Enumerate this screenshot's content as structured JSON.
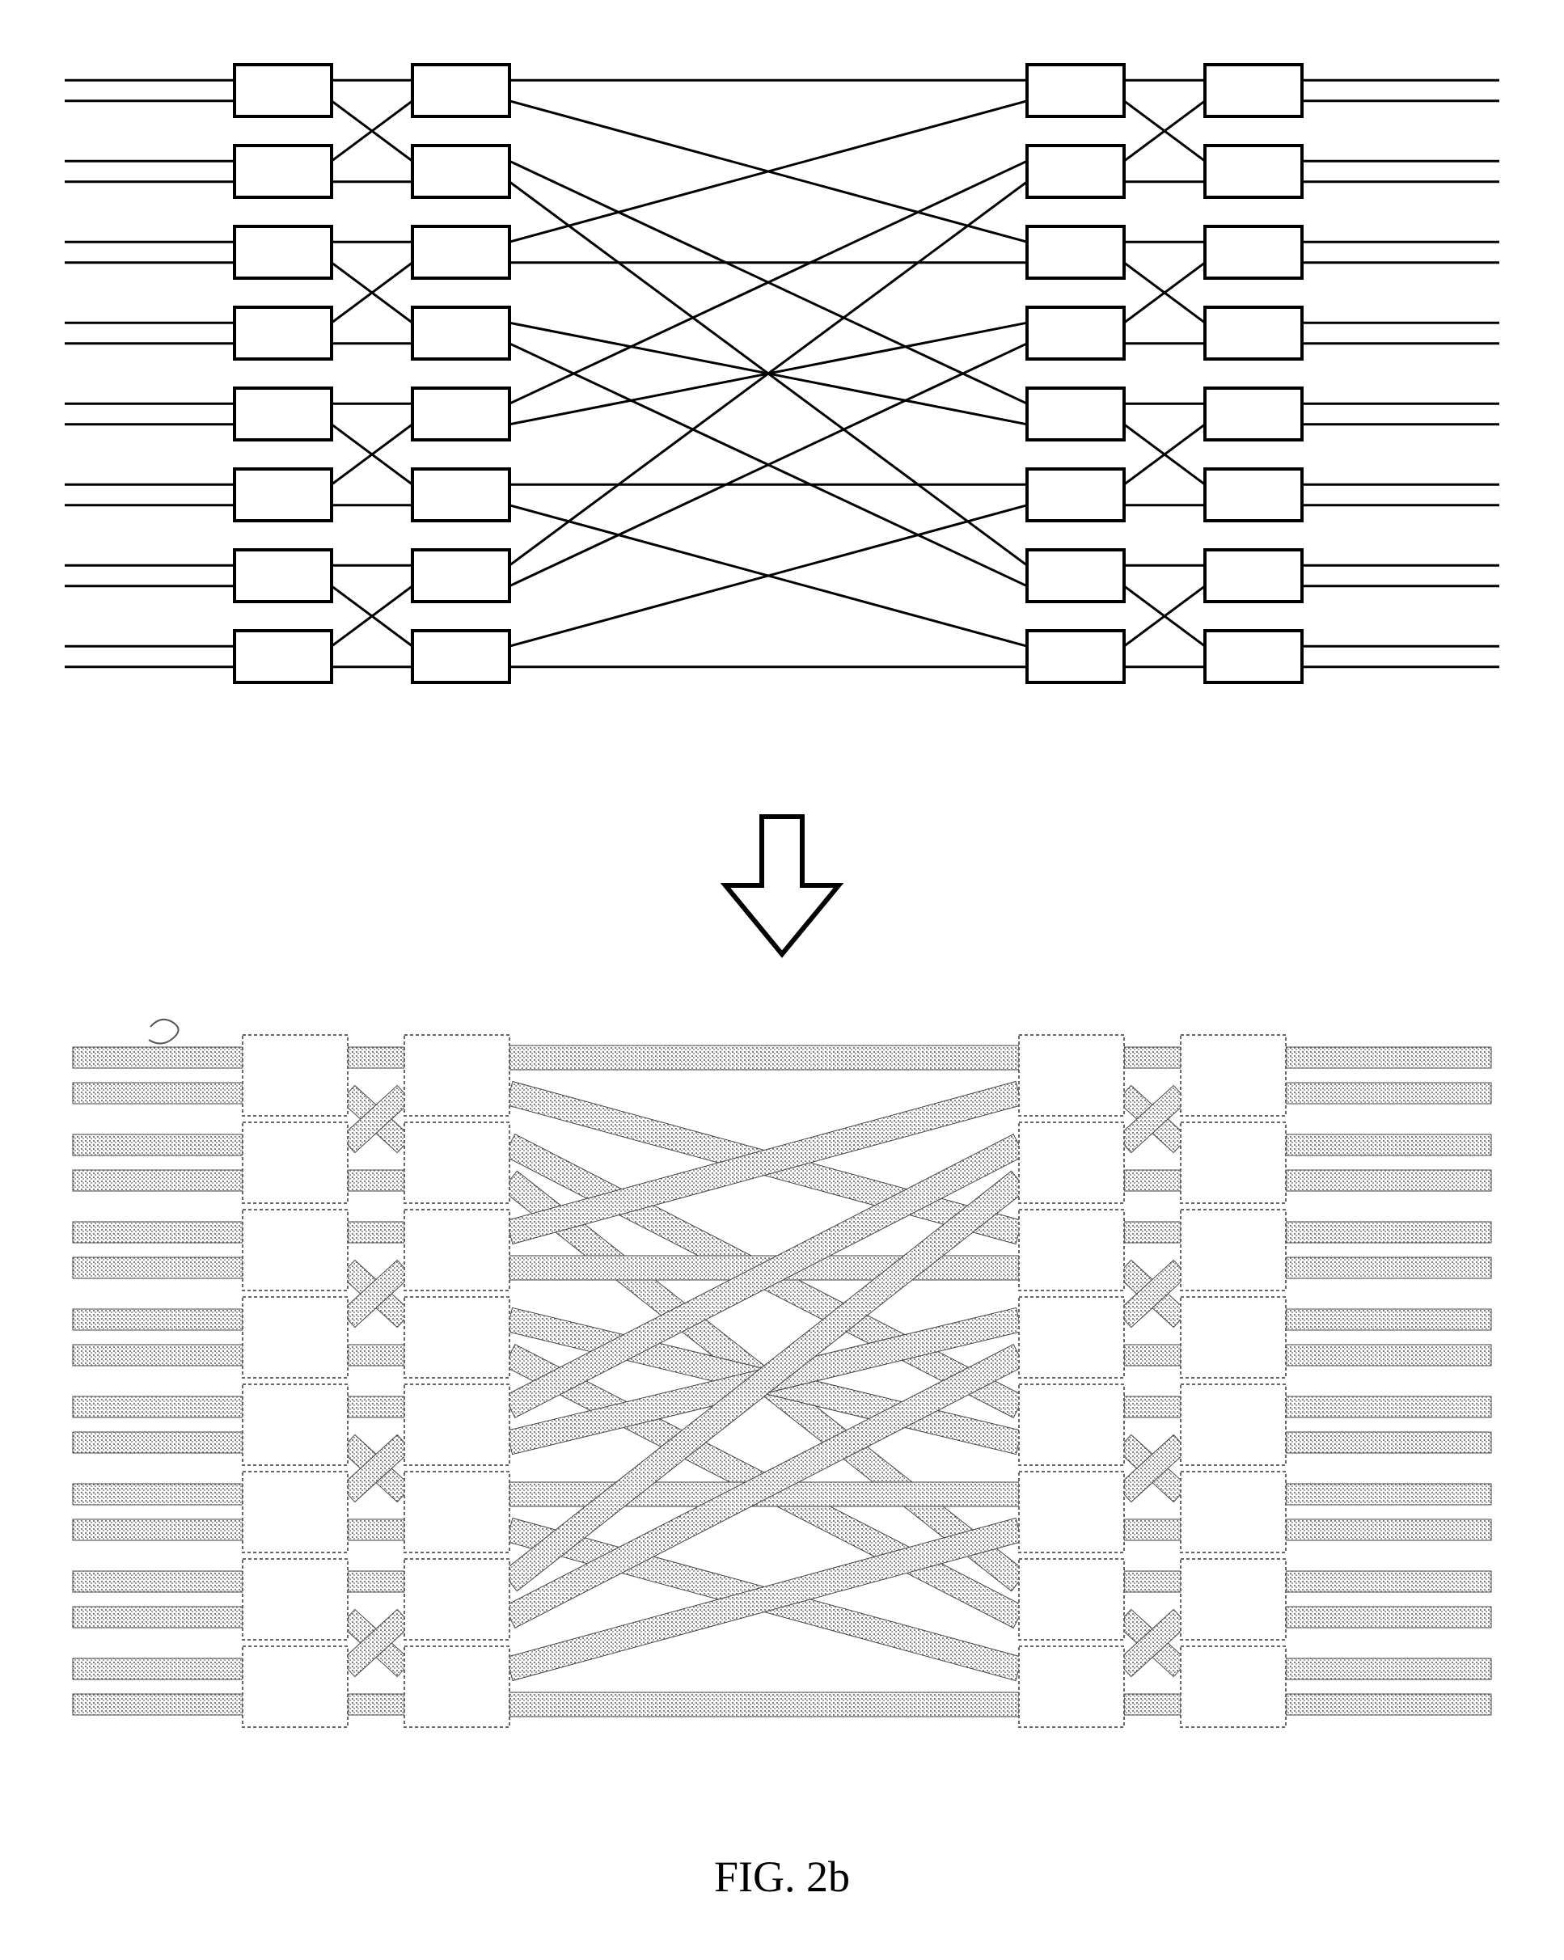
{
  "figure_label": "FIG. 2b",
  "diagram": {
    "description": "Two Benes-style multistage interconnection network diagrams. The upper diagram uses thin single-line wires between small rectangular switch nodes; the lower diagram is the same topology rendered with thick hatched bus-style wiring, indicating expansion from scalar lines to multi-bit buses. A downward block arrow between them indicates transformation.",
    "stages": 4,
    "switches_per_stage": 8,
    "io_lines_per_switch": 2,
    "total_io_lines": 16,
    "center_shuffle": "4-group perfect shuffle (groups of 4 ↔ groups of 4)"
  }
}
